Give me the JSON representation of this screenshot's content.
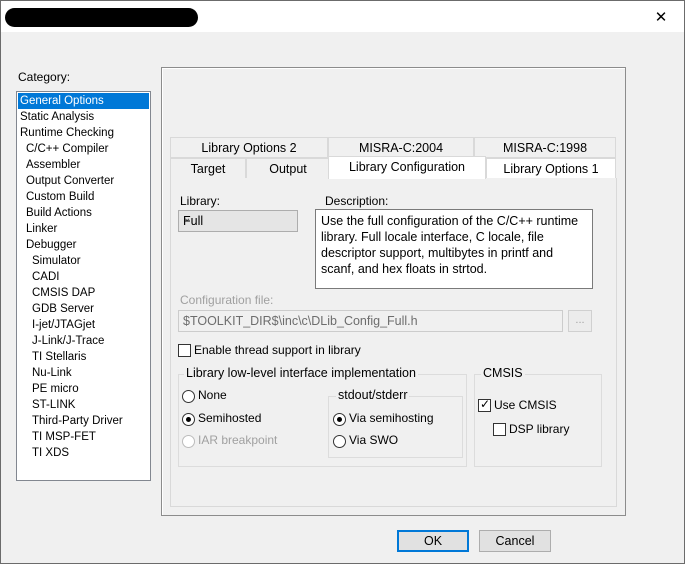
{
  "window": {
    "close_icon": "✕"
  },
  "category": {
    "label": "Category:",
    "items": [
      "General Options",
      "Static Analysis",
      "Runtime Checking",
      "C/C++ Compiler",
      "Assembler",
      "Output Converter",
      "Custom Build",
      "Build Actions",
      "Linker",
      "Debugger",
      "Simulator",
      "CADI",
      "CMSIS DAP",
      "GDB Server",
      "I-jet/JTAGjet",
      "J-Link/J-Trace",
      "TI Stellaris",
      "Nu-Link",
      "PE micro",
      "ST-LINK",
      "Third-Party Driver",
      "TI MSP-FET",
      "TI XDS"
    ],
    "selected": "General Options"
  },
  "tabs": {
    "row1": [
      "Library Options 2",
      "MISRA-C:2004",
      "MISRA-C:1998"
    ],
    "row2": [
      "Target",
      "Output",
      "Library Configuration",
      "Library Options 1"
    ],
    "active": "Library Configuration"
  },
  "library": {
    "label": "Library:",
    "value": "Full",
    "description_label": "Description:",
    "description": "Use the full configuration of the C/C++ runtime library. Full locale interface, C locale, file descriptor support, multibytes in printf and scanf, and hex floats in strtod."
  },
  "config_file": {
    "label": "Configuration file:",
    "value": "$TOOLKIT_DIR$\\inc\\c\\DLib_Config_Full.h",
    "browse_label": "..."
  },
  "thread_support": {
    "label": "Enable thread support in library",
    "checked": false
  },
  "low_level": {
    "title": "Library low-level interface implementation",
    "options": [
      "None",
      "Semihosted",
      "IAR breakpoint"
    ],
    "selected": "Semihosted"
  },
  "stdout": {
    "title": "stdout/stderr",
    "options": [
      "Via semihosting",
      "Via SWO"
    ],
    "selected": "Via semihosting"
  },
  "cmsis": {
    "title": "CMSIS",
    "use_cmsis_label": "Use CMSIS",
    "use_cmsis_checked": true,
    "dsp_label": "DSP library",
    "dsp_checked": false
  },
  "buttons": {
    "ok": "OK",
    "cancel": "Cancel"
  }
}
